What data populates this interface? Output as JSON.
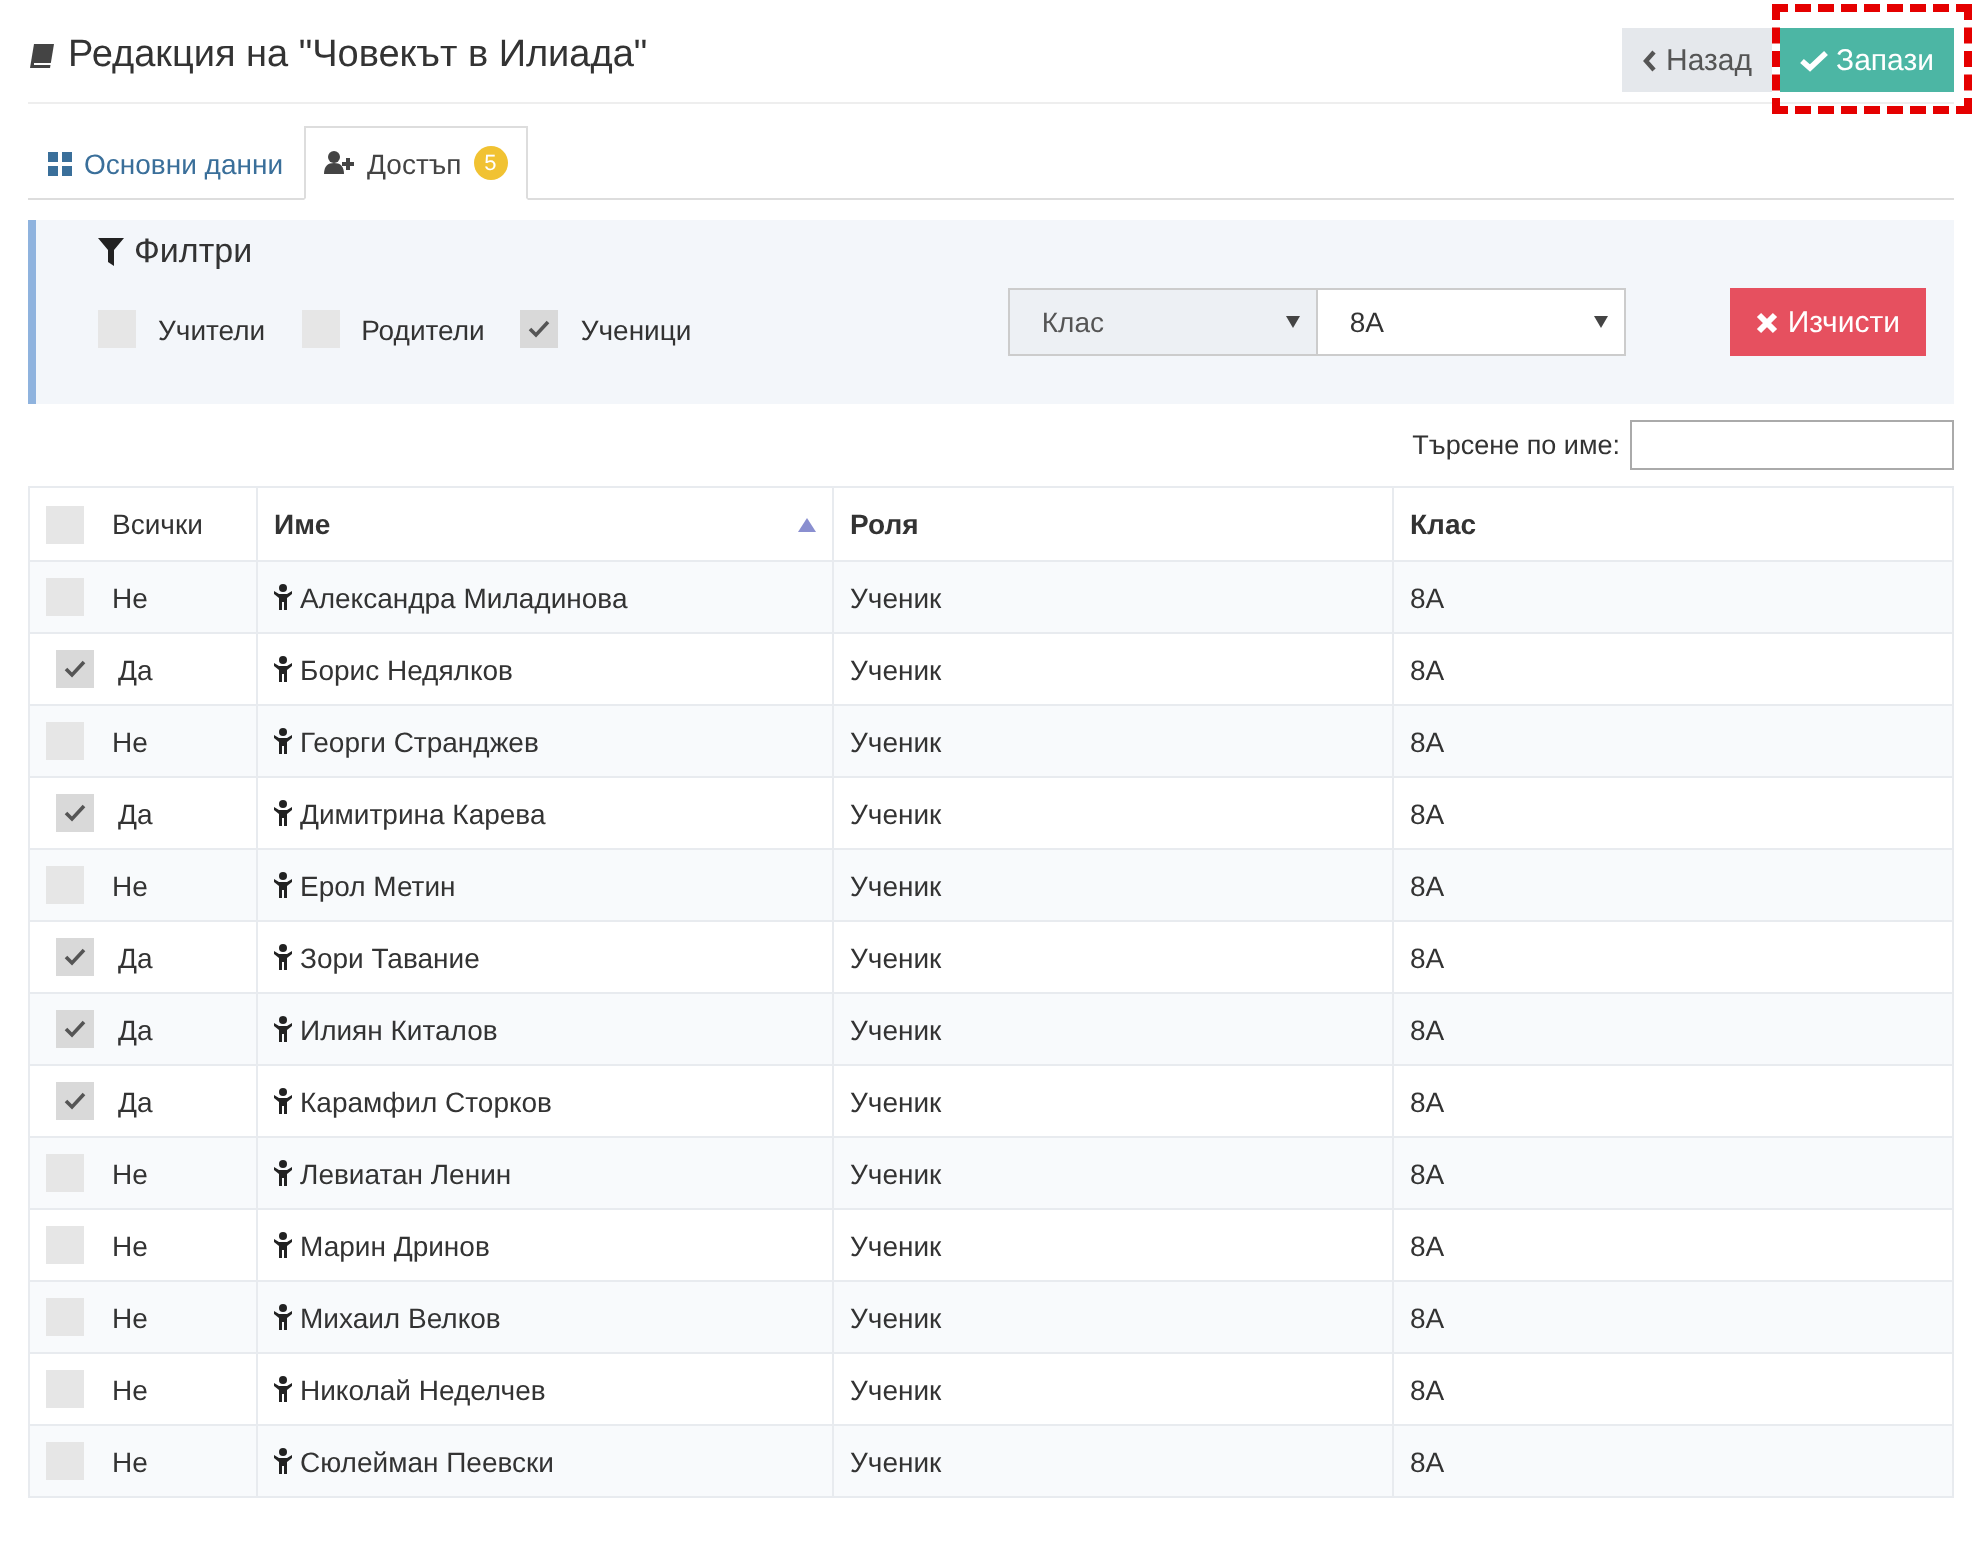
{
  "page": {
    "title": "Редакция на \"Човекът в Илиада\""
  },
  "buttons": {
    "back": "Назад",
    "save": {
      "label": "Запази",
      "highlighted": true
    }
  },
  "tabs": [
    {
      "label": "Основни данни",
      "selected": false
    },
    {
      "label": "Достъп",
      "selected": true,
      "badge": "5"
    }
  ],
  "filters": {
    "title": "Филтри",
    "checkboxes": [
      {
        "label": "Учители",
        "checked": false
      },
      {
        "label": "Родители",
        "checked": false
      },
      {
        "label": "Ученици",
        "checked": true
      }
    ],
    "field_select": {
      "value": "Клас"
    },
    "value_select": {
      "value": "8А"
    },
    "clear_button": "Изчисти"
  },
  "search": {
    "label": "Търсене по име:"
  },
  "table": {
    "select_all": {
      "label": "Всички",
      "checked": false
    },
    "columns": [
      {
        "label": "Име",
        "sorted": true
      },
      {
        "label": "Роля",
        "sorted": false
      },
      {
        "label": "Клас",
        "sorted": false
      }
    ],
    "rows": [
      {
        "checked": false,
        "access": "Не",
        "name": "Александра Миладинова",
        "role": "Ученик",
        "class": "8А"
      },
      {
        "checked": true,
        "access": "Да",
        "name": "Борис Недялков",
        "role": "Ученик",
        "class": "8А"
      },
      {
        "checked": false,
        "access": "Не",
        "name": "Георги Странджев",
        "role": "Ученик",
        "class": "8А"
      },
      {
        "checked": true,
        "access": "Да",
        "name": "Димитрина Карева",
        "role": "Ученик",
        "class": "8А"
      },
      {
        "checked": false,
        "access": "Не",
        "name": "Ерол Метин",
        "role": "Ученик",
        "class": "8А"
      },
      {
        "checked": true,
        "access": "Да",
        "name": "Зори Тавание",
        "role": "Ученик",
        "class": "8А"
      },
      {
        "checked": true,
        "access": "Да",
        "name": "Илиян Киталов",
        "role": "Ученик",
        "class": "8А"
      },
      {
        "checked": true,
        "access": "Да",
        "name": "Карамфил Сторков",
        "role": "Ученик",
        "class": "8А"
      },
      {
        "checked": false,
        "access": "Не",
        "name": "Левиатан Ленин",
        "role": "Ученик",
        "class": "8А"
      },
      {
        "checked": false,
        "access": "Не",
        "name": "Марин Дринов",
        "role": "Ученик",
        "class": "8А"
      },
      {
        "checked": false,
        "access": "Не",
        "name": "Михаил Велков",
        "role": "Ученик",
        "class": "8А"
      },
      {
        "checked": false,
        "access": "Не",
        "name": "Николай Неделчев",
        "role": "Ученик",
        "class": "8А"
      },
      {
        "checked": false,
        "access": "Не",
        "name": "Сюлейман Пеевски",
        "role": "Ученик",
        "class": "8А"
      }
    ]
  }
}
